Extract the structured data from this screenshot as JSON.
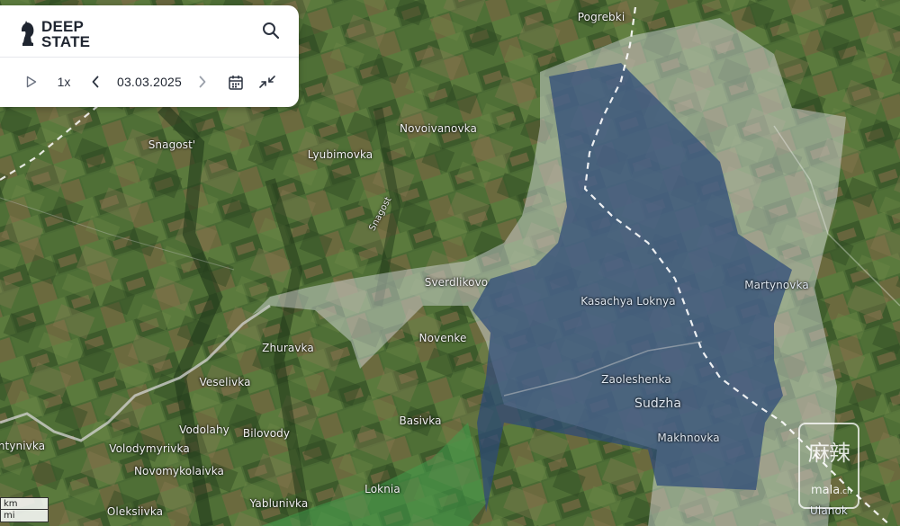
{
  "app": {
    "brand_line1": "DEEP",
    "brand_line2": "STATE",
    "logo": "knight-chess-icon"
  },
  "toolbar": {
    "play_icon": "play-icon",
    "speed": "1x",
    "prev_icon": "chevron-left-icon",
    "date": "03.03.2025",
    "next_icon": "chevron-right-icon",
    "calendar_icon": "calendar-icon",
    "collapse_icon": "collapse-arrows-icon",
    "search_icon": "search-icon"
  },
  "map": {
    "places": [
      {
        "id": "pogrebki",
        "label": "Pogrebki"
      },
      {
        "id": "novoivanovka",
        "label": "Novoivanovka"
      },
      {
        "id": "snagost",
        "label": "Snagost'"
      },
      {
        "id": "lyubimovka",
        "label": "Lyubimovka"
      },
      {
        "id": "snagost-river",
        "label": "Snagost"
      },
      {
        "id": "sverdlikovo",
        "label": "Sverdlikovo"
      },
      {
        "id": "kasachya-loknya",
        "label": "Kasachya Loknya"
      },
      {
        "id": "martynovka",
        "label": "Martynovka"
      },
      {
        "id": "novenke",
        "label": "Novenke"
      },
      {
        "id": "zhuravka",
        "label": "Zhuravka"
      },
      {
        "id": "veselivka",
        "label": "Veselivka"
      },
      {
        "id": "zaoleshenka",
        "label": "Zaoleshenka"
      },
      {
        "id": "sudzha",
        "label": "Sudzha"
      },
      {
        "id": "vodolahy",
        "label": "Vodolahy"
      },
      {
        "id": "basivka",
        "label": "Basivka"
      },
      {
        "id": "makhnovka",
        "label": "Makhnovka"
      },
      {
        "id": "kostiantynivka",
        "label": "ntynivka"
      },
      {
        "id": "volodymyrivka",
        "label": "Volodymyrivka"
      },
      {
        "id": "bilovody",
        "label": "Bilovody"
      },
      {
        "id": "novomykolaivka",
        "label": "Novomykolaivka"
      },
      {
        "id": "loknia",
        "label": "Loknia"
      },
      {
        "id": "yablunivka",
        "label": "Yablunivka"
      },
      {
        "id": "oleksiivka",
        "label": "Oleksiivka"
      },
      {
        "id": "ulanok",
        "label": "Ulanok"
      }
    ],
    "colors": {
      "occupied": "#2c4a78",
      "contested": "#d8dde3",
      "liberated": "#3f9a4a",
      "border": "#d0d0d0"
    }
  },
  "scale": {
    "km_label": "km",
    "mi_label": "mi"
  },
  "watermark": {
    "chinese": "麻辣",
    "latin": "mala",
    "suffix": ".cn"
  }
}
